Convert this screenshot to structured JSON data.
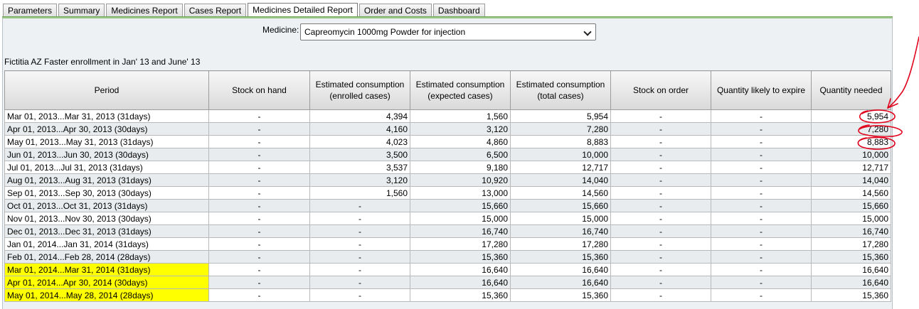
{
  "tabs": [
    {
      "label": "Parameters",
      "active": false
    },
    {
      "label": "Summary",
      "active": false
    },
    {
      "label": "Medicines Report",
      "active": false
    },
    {
      "label": "Cases Report",
      "active": false
    },
    {
      "label": "Medicines Detailed Report",
      "active": true
    },
    {
      "label": "Order and Costs",
      "active": false
    },
    {
      "label": "Dashboard",
      "active": false
    }
  ],
  "medicine": {
    "label": "Medicine:",
    "selected": "Capreomycin  1000mg  Powder for injection"
  },
  "report_title": "Fictitia AZ Faster enrollment in Jan' 13 and June' 13",
  "table": {
    "headers": [
      "Period",
      "Stock on hand",
      "Estimated consumption (enrolled cases)",
      "Estimated consumption (expected cases)",
      "Estimated consumption (total cases)",
      "Stock on order",
      "Quantity likely to expire",
      "Quantity needed"
    ],
    "rows": [
      {
        "period": "Mar 01, 2013...Mar 31, 2013 (31days)",
        "stock": "-",
        "enrolled": "4,394",
        "expected": "1,560",
        "total": "5,954",
        "order": "-",
        "expire": "-",
        "needed": "5,954",
        "highlight": false
      },
      {
        "period": "Apr 01, 2013...Apr 30, 2013 (30days)",
        "stock": "-",
        "enrolled": "4,160",
        "expected": "3,120",
        "total": "7,280",
        "order": "-",
        "expire": "-",
        "needed": "7,280",
        "highlight": false
      },
      {
        "period": "May 01, 2013...May 31, 2013 (31days)",
        "stock": "-",
        "enrolled": "4,023",
        "expected": "4,860",
        "total": "8,883",
        "order": "-",
        "expire": "-",
        "needed": "8,883",
        "highlight": false
      },
      {
        "period": "Jun 01, 2013...Jun 30, 2013 (30days)",
        "stock": "-",
        "enrolled": "3,500",
        "expected": "6,500",
        "total": "10,000",
        "order": "-",
        "expire": "-",
        "needed": "10,000",
        "highlight": false
      },
      {
        "period": "Jul 01, 2013...Jul 31, 2013 (31days)",
        "stock": "-",
        "enrolled": "3,537",
        "expected": "9,180",
        "total": "12,717",
        "order": "-",
        "expire": "-",
        "needed": "12,717",
        "highlight": false
      },
      {
        "period": "Aug 01, 2013...Aug 31, 2013 (31days)",
        "stock": "-",
        "enrolled": "3,120",
        "expected": "10,920",
        "total": "14,040",
        "order": "-",
        "expire": "-",
        "needed": "14,040",
        "highlight": false
      },
      {
        "period": "Sep 01, 2013...Sep 30, 2013 (30days)",
        "stock": "-",
        "enrolled": "1,560",
        "expected": "13,000",
        "total": "14,560",
        "order": "-",
        "expire": "-",
        "needed": "14,560",
        "highlight": false
      },
      {
        "period": "Oct 01, 2013...Oct 31, 2013 (31days)",
        "stock": "-",
        "enrolled": "-",
        "expected": "15,660",
        "total": "15,660",
        "order": "-",
        "expire": "-",
        "needed": "15,660",
        "highlight": false
      },
      {
        "period": "Nov 01, 2013...Nov 30, 2013 (30days)",
        "stock": "-",
        "enrolled": "-",
        "expected": "15,000",
        "total": "15,000",
        "order": "-",
        "expire": "-",
        "needed": "15,000",
        "highlight": false
      },
      {
        "period": "Dec 01, 2013...Dec 31, 2013 (31days)",
        "stock": "-",
        "enrolled": "-",
        "expected": "16,740",
        "total": "16,740",
        "order": "-",
        "expire": "-",
        "needed": "16,740",
        "highlight": false
      },
      {
        "period": "Jan 01, 2014...Jan 31, 2014 (31days)",
        "stock": "-",
        "enrolled": "-",
        "expected": "17,280",
        "total": "17,280",
        "order": "-",
        "expire": "-",
        "needed": "17,280",
        "highlight": false
      },
      {
        "period": "Feb 01, 2014...Feb 28, 2014 (28days)",
        "stock": "-",
        "enrolled": "-",
        "expected": "15,360",
        "total": "15,360",
        "order": "-",
        "expire": "-",
        "needed": "15,360",
        "highlight": false
      },
      {
        "period": "Mar 01, 2014...Mar 31, 2014 (31days)",
        "stock": "-",
        "enrolled": "-",
        "expected": "16,640",
        "total": "16,640",
        "order": "-",
        "expire": "-",
        "needed": "16,640",
        "highlight": true
      },
      {
        "period": "Apr 01, 2014...Apr 30, 2014 (30days)",
        "stock": "-",
        "enrolled": "-",
        "expected": "16,640",
        "total": "16,640",
        "order": "-",
        "expire": "-",
        "needed": "16,640",
        "highlight": true
      },
      {
        "period": "May 01, 2014...May 28, 2014 (28days)",
        "stock": "-",
        "enrolled": "-",
        "expected": "15,360",
        "total": "15,360",
        "order": "-",
        "expire": "-",
        "needed": "15,360",
        "highlight": true
      }
    ]
  },
  "colors": {
    "highlight": "#ffff00",
    "annotation": "#e0001b",
    "tab_underline": "#9cc88a"
  }
}
